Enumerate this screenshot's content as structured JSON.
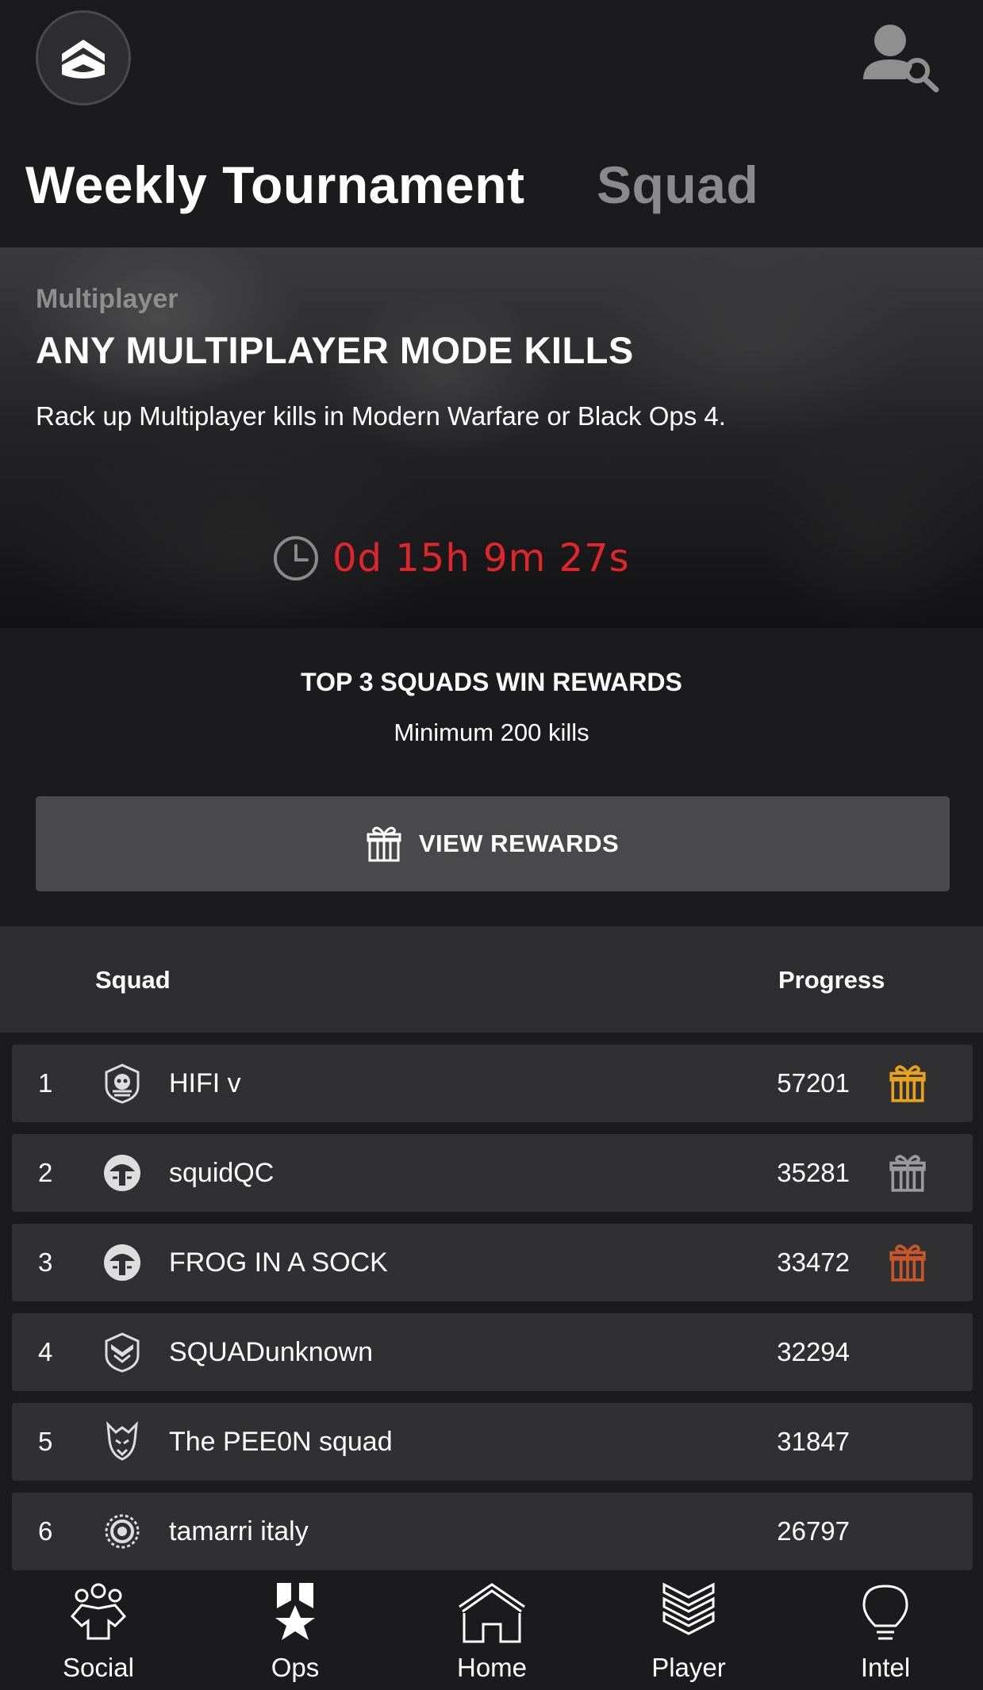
{
  "header": {
    "tabs": [
      {
        "label": "Weekly Tournament",
        "active": true
      },
      {
        "label": "Squad",
        "active": false
      }
    ],
    "logo_icon": "app-logo-icon",
    "profile_search_icon": "profile-search-icon"
  },
  "event": {
    "category": "Multiplayer",
    "title": "ANY MULTIPLAYER MODE KILLS",
    "description": "Rack up Multiplayer kills in Modern Warfare or Black Ops 4.",
    "countdown": "0d 15h 9m 27s",
    "countdown_color": "#e0262b"
  },
  "rewards": {
    "headline": "TOP 3 SQUADS WIN REWARDS",
    "requirement": "Minimum 200 kills",
    "button_label": "VIEW REWARDS"
  },
  "table": {
    "columns": {
      "squad": "Squad",
      "progress": "Progress"
    },
    "rows": [
      {
        "rank": "1",
        "name": "HIFI v",
        "progress": "57201",
        "reward": "gold",
        "reward_color": "#e8a21a"
      },
      {
        "rank": "2",
        "name": "squidQC",
        "progress": "35281",
        "reward": "silver",
        "reward_color": "#9a9a9a"
      },
      {
        "rank": "3",
        "name": "FROG IN A SOCK",
        "progress": "33472",
        "reward": "bronze",
        "reward_color": "#c7562a"
      },
      {
        "rank": "4",
        "name": "SQUADunknown",
        "progress": "32294",
        "reward": null
      },
      {
        "rank": "5",
        "name": "The PEE0N squad",
        "progress": "31847",
        "reward": null
      },
      {
        "rank": "6",
        "name": "tamarri italy",
        "progress": "26797",
        "reward": null
      }
    ]
  },
  "nav": {
    "items": [
      {
        "label": "Social",
        "icon": "social-icon"
      },
      {
        "label": "Ops",
        "icon": "ops-icon"
      },
      {
        "label": "Home",
        "icon": "home-icon"
      },
      {
        "label": "Player",
        "icon": "player-icon"
      },
      {
        "label": "Intel",
        "icon": "intel-icon"
      }
    ]
  }
}
